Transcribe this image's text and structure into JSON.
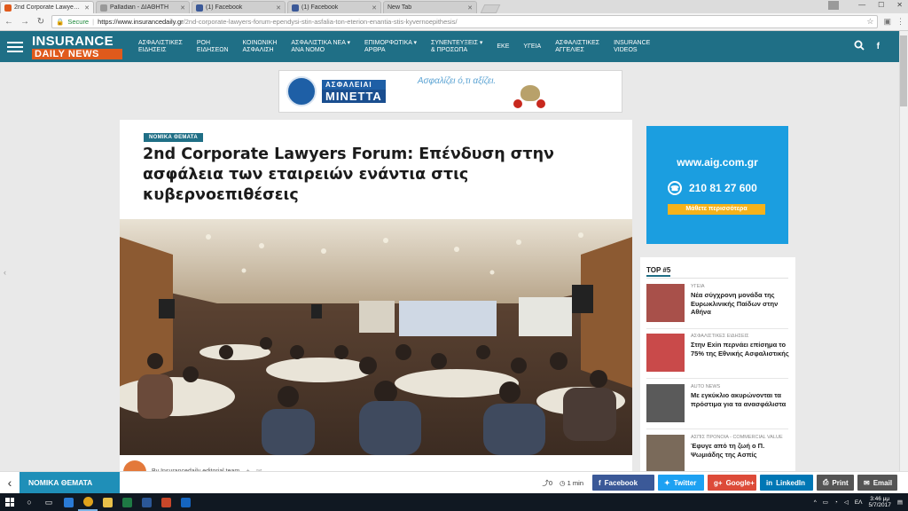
{
  "browser": {
    "tabs": [
      {
        "title": "2nd Corporate Lawyers F",
        "favicon_color": "#e05a1c",
        "active": true
      },
      {
        "title": "Palladian - ΔΙΑΘΗΤΗ",
        "favicon_color": "#999999",
        "active": false
      },
      {
        "title": "(1) Facebook",
        "favicon_color": "#3b5998",
        "active": false
      },
      {
        "title": "(1) Facebook",
        "favicon_color": "#3b5998",
        "active": false
      },
      {
        "title": "New Tab",
        "favicon_color": "",
        "active": false
      }
    ],
    "secure_label": "Secure",
    "url_host": "https://www.insurancedaily.gr",
    "url_path": "/2nd-corporate-lawyers-forum-ependysi-stin-asfalia-ton-eterion-enantia-stis-kyvernoepithesis/"
  },
  "site": {
    "logo_top": "INSURANCE",
    "logo_bottom": "DAILY NEWS",
    "nav": [
      {
        "l1": "ΑΣΦΑΛΙΣΤΙΚΕΣ",
        "l2": "ΕΙΔΗΣΕΙΣ"
      },
      {
        "l1": "ΡΟΗ",
        "l2": "ΕΙΔΗΣΕΩΝ"
      },
      {
        "l1": "ΚΟΙΝΩΝΙΚΗ",
        "l2": "ΑΣΦΑΛΙΣΗ"
      },
      {
        "l1": "ΑΣΦΑΛΙΣΤΙΚΑ ΝΕΑ ▾",
        "l2": "ΑΝΑ ΝΟΜΟ"
      },
      {
        "l1": "ΕΠΙΜΟΡΦΩΤΙΚΑ ▾",
        "l2": "ΑΡΘΡΑ"
      },
      {
        "l1": "ΣΥΝΕΝΤΕΥΞΕΙΣ ▾",
        "l2": "& ΠΡΟΣΩΠΑ"
      },
      {
        "l1": "ΕΚΕ",
        "l2": ""
      },
      {
        "l1": "ΥΓΕΙΑ",
        "l2": ""
      },
      {
        "l1": "ΑΣΦΑΛΙΣΤΙΚΕΣ",
        "l2": "ΑΓΓΕΛΙΕΣ"
      },
      {
        "l1": "INSURANCE",
        "l2": "VIDEOS"
      }
    ]
  },
  "top_ad": {
    "brand_top": "ΑΣΦΑΛΕΙΑΙ",
    "brand_bottom": "ΜΙΝΕΤΤΑ",
    "slogan": "Ασφαλίζει ό,τι αξίζει."
  },
  "article": {
    "category": "ΝΟΜΙΚΑ ΘΕΜΑΤΑ",
    "title": "2nd Corporate Lawyers Forum: Επένδυση στην ασφάλεια των εταιρειών ενάντια στις κυβερνοεπιθέσεις",
    "byline": "By Insurancedaily editorial team"
  },
  "side_ad": {
    "url": "www.aig.com.gr",
    "phone": "210 81 27 600",
    "cta": "Μάθετε περισσότερα"
  },
  "top5": {
    "title": "TOP #5",
    "items": [
      {
        "category": "ΥΓΕΙΑ",
        "title": "Νέα σύγχρονη μονάδα της Ευρωκλινικής Παίδων στην Αθήνα",
        "thumb_color": "#a8504a"
      },
      {
        "category": "ΑΣΦΑΛΙΣΤΙΚΕΣ ΕΙΔΗΣΕΙΣ",
        "title": "Στην Exin περνάει επίσημα το 75% της Εθνικής Ασφαλιστικής",
        "thumb_color": "#c94a4a"
      },
      {
        "category": "AUTO NEWS",
        "title": "Με εγκύκλιο ακυρώνονται τα πρόστιμα για τα ανασφάλιστα",
        "thumb_color": "#5a5a5a"
      },
      {
        "category": "ΑΣΠΙΣ ΠΡΟΝΟΙΑ - COMMERCIAL VALUE",
        "title": "Έφυγε από τη ζωή ο Π. Ψωμιάδης της Ασπίς",
        "thumb_color": "#7a6a5a"
      }
    ]
  },
  "sharebar": {
    "category": "ΝΟΜΙΚΑ ΘΕΜΑΤΑ",
    "share_count": "0",
    "read_time": "1 min",
    "buttons": {
      "facebook": "Facebook",
      "twitter": "Twitter",
      "google": "Google+",
      "linkedin": "LinkedIn",
      "print": "Print",
      "email": "Email"
    }
  },
  "taskbar": {
    "lang": "ΕΛ",
    "time": "3:46 μμ",
    "date": "5/7/2017"
  }
}
